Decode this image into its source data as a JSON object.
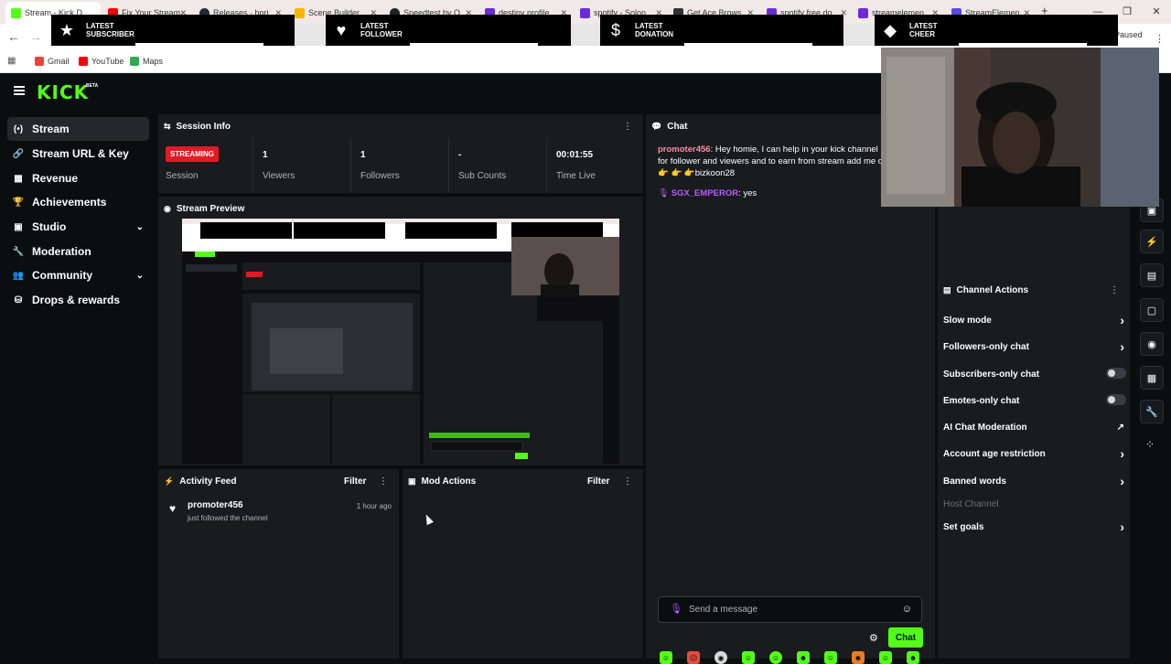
{
  "browser": {
    "tabs": [
      {
        "title": "Stream - Kick D",
        "color": "#53fc18"
      },
      {
        "title": "Fix Your Stream",
        "color": "#ff0000"
      },
      {
        "title": "Releases · bori",
        "color": "#24292f"
      },
      {
        "title": "Scene Builder",
        "color": "#f7b500"
      },
      {
        "title": "Speedtest by O",
        "color": "#222222"
      },
      {
        "title": "destiny profile",
        "color": "#6c2bd9"
      },
      {
        "title": "spotify - Solon",
        "color": "#6c2bd9"
      },
      {
        "title": "Get Ace Brows",
        "color": "#333333"
      },
      {
        "title": "spotify free do",
        "color": "#6c2bd9"
      },
      {
        "title": "streamelemen",
        "color": "#6c2bd9"
      },
      {
        "title": "StreamElemen",
        "color": "#5b4bdb"
      }
    ],
    "new_tab": "+",
    "paused": "Paused",
    "bookmarks": [
      {
        "label": "Gmail",
        "color": "#ea4335"
      },
      {
        "label": "YouTube",
        "color": "#ff0000"
      },
      {
        "label": "Maps",
        "color": "#34a853"
      }
    ]
  },
  "overlay": {
    "alerts": [
      {
        "icon": "star-icon",
        "glyph": "★",
        "line1": "LATEST",
        "line2": "SUBSCRIBER"
      },
      {
        "icon": "heart-icon",
        "glyph": "♥",
        "line1": "LATEST",
        "line2": "FOLLOWER"
      },
      {
        "icon": "dollar-icon",
        "glyph": "$",
        "line1": "LATEST",
        "line2": "DONATION"
      },
      {
        "icon": "diamond-icon",
        "glyph": "◆",
        "line1": "LATEST",
        "line2": "CHEER"
      }
    ]
  },
  "app": {
    "logo": "KICK",
    "logo_badge": "BETA",
    "nav": [
      {
        "label": "Stream",
        "glyph": "(•)",
        "icon": "broadcast-icon",
        "active": true
      },
      {
        "label": "Stream URL & Key",
        "glyph": "🔗",
        "icon": "link-icon"
      },
      {
        "label": "Revenue",
        "glyph": "▦",
        "icon": "revenue-icon"
      },
      {
        "label": "Achievements",
        "glyph": "🏆",
        "icon": "trophy-icon"
      },
      {
        "label": "Studio",
        "glyph": "▣",
        "icon": "studio-icon",
        "chevron": "⌄"
      },
      {
        "label": "Moderation",
        "glyph": "🔧",
        "icon": "wrench-icon"
      },
      {
        "label": "Community",
        "glyph": "👥",
        "icon": "community-icon",
        "chevron": "⌄"
      },
      {
        "label": "Drops & rewards",
        "glyph": "⛁",
        "icon": "gift-icon"
      }
    ]
  },
  "session": {
    "title": "Session Info",
    "badge": "STREAMING",
    "session_label": "Session",
    "stats": [
      {
        "value": "1",
        "label": "Viewers"
      },
      {
        "value": "1",
        "label": "Followers"
      },
      {
        "value": "-",
        "label": "Sub Counts"
      },
      {
        "value": "00:01:55",
        "label": "Time Live"
      }
    ]
  },
  "preview": {
    "title": "Stream Preview"
  },
  "activity": {
    "title": "Activity Feed",
    "filter": "Filter",
    "items": [
      {
        "user": "promoter456",
        "action": "just followed the channel",
        "time": "1 hour ago"
      }
    ]
  },
  "mod_actions": {
    "title": "Mod Actions",
    "filter": "Filter"
  },
  "chat": {
    "title": "Chat",
    "messages": [
      {
        "user": "promoter456",
        "user_color": "#ff8ba7",
        "text_lines": [
          "Hey homie, I can help in your kick channel pr",
          "for follower and viewers and to earn from stream add me on",
          "👉 👉 👉bizkoon28"
        ]
      },
      {
        "user": "SGX_EMPEROR",
        "user_color": "#b65cff",
        "text": "yes"
      }
    ],
    "input_placeholder": "Send a message",
    "send_label": "Chat"
  },
  "channel_actions": {
    "title": "Channel Actions",
    "rows": [
      {
        "label": "Slow mode",
        "control": "arrow"
      },
      {
        "label": "Followers-only chat",
        "control": "arrow"
      },
      {
        "label": "Subscribers-only chat",
        "control": "toggle",
        "state": "off"
      },
      {
        "label": "Emotes-only chat",
        "control": "toggle",
        "state": "off"
      },
      {
        "label": "AI Chat Moderation",
        "control": "external"
      },
      {
        "label": "Account age restriction",
        "control": "arrow"
      },
      {
        "label": "Banned words",
        "control": "arrow"
      },
      {
        "label": "Host Channel",
        "control": "disabled"
      },
      {
        "label": "Set goals",
        "control": "arrow"
      }
    ]
  },
  "colors": {
    "accent": "#53fc18",
    "live": "#e01b24",
    "panel": "#191b1f",
    "bg": "#0b0e0f"
  }
}
